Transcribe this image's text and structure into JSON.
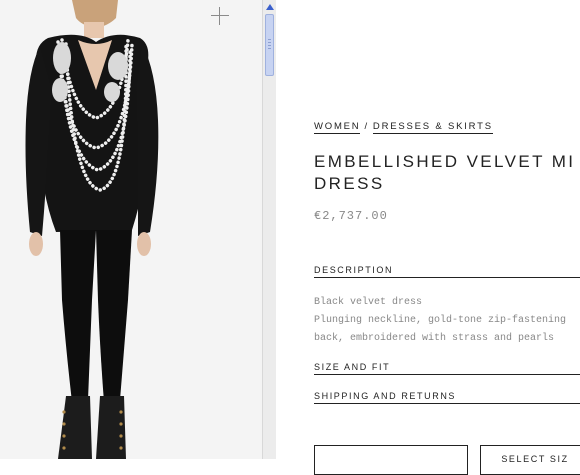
{
  "product": {
    "breadcrumb": [
      {
        "label": "WOMEN"
      },
      {
        "label": "DRESSES & SKIRTS"
      }
    ],
    "breadcrumb_separator": "/",
    "title": "EMBELLISHED VELVET MI\nDRESS",
    "price": "€2,737.00"
  },
  "sections": {
    "description": {
      "label": "DESCRIPTION",
      "lines": [
        "Black velvet dress",
        "Plunging neckline, gold-tone zip-fastening",
        "back, embroidered with strass and pearls"
      ]
    },
    "size_and_fit": {
      "label": "SIZE AND FIT"
    },
    "shipping_and_returns": {
      "label": "SHIPPING AND RETURNS"
    }
  },
  "actions": {
    "size_button_label": "",
    "select_size_label": "SELECT SIZ"
  },
  "colors": {
    "dress": "#111111",
    "pearls": "#f2f2f2",
    "text": "#222222",
    "muted_text": "#888888",
    "scroll_arrow": "#3a5fcc"
  },
  "icons": {
    "zoom": "plus-icon",
    "scroll_up": "arrow-up-icon"
  }
}
